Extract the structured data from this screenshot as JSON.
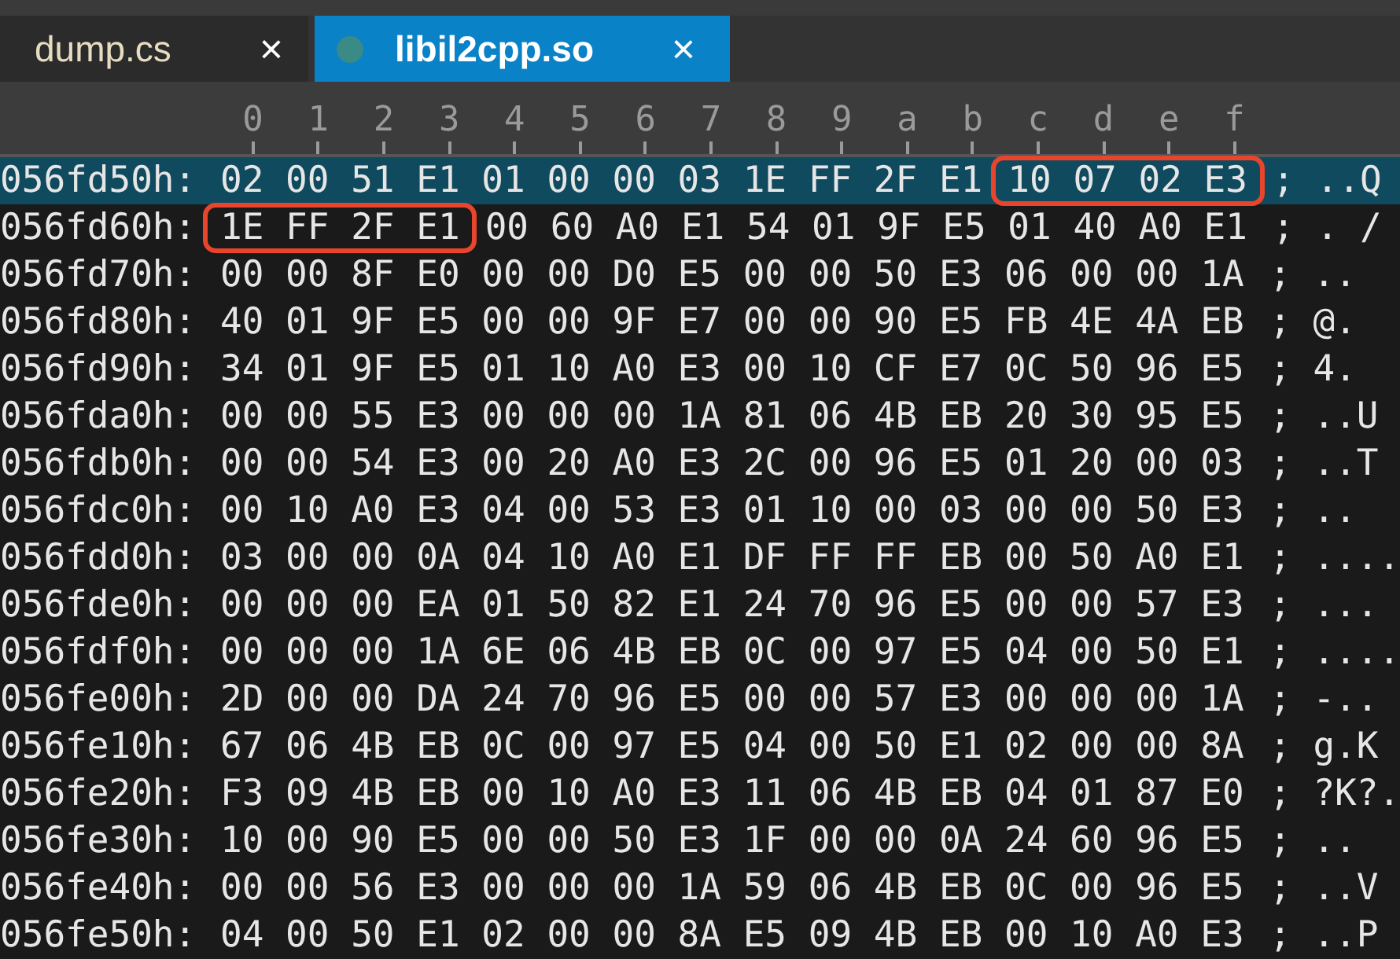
{
  "tabs": [
    {
      "label": "dump.cs",
      "close": "×",
      "selected": false,
      "modified": false
    },
    {
      "label": "libil2cpp.so",
      "close": "×",
      "selected": true,
      "modified": true
    }
  ],
  "columns": [
    "0",
    "1",
    "2",
    "3",
    "4",
    "5",
    "6",
    "7",
    "8",
    "9",
    "a",
    "b",
    "c",
    "d",
    "e",
    "f"
  ],
  "rows": [
    {
      "offset": "056fd50h:",
      "hex": [
        {
          "text": "02 00 51 E1 01 00 00 03 1E FF 2F E1",
          "marked": false
        },
        {
          "text": "10 07 02 E3",
          "marked": true
        }
      ],
      "separator": ";",
      "ascii": "..Q",
      "selected": true
    },
    {
      "offset": "056fd60h:",
      "hex": [
        {
          "text": "1E FF 2F E1",
          "marked": true
        },
        {
          "text": "00 60 A0 E1 54 01 9F E5 01 40 A0 E1",
          "marked": false
        }
      ],
      "separator": ";",
      "ascii": ". /",
      "selected": false
    },
    {
      "offset": "056fd70h:",
      "hex": [
        {
          "text": "00 00 8F E0 00 00 D0 E5 00 00 50 E3 06 00 00 1A",
          "marked": false
        }
      ],
      "separator": ";",
      "ascii": "..",
      "selected": false
    },
    {
      "offset": "056fd80h:",
      "hex": [
        {
          "text": "40 01 9F E5 00 00 9F E7 00 00 90 E5 FB 4E 4A EB",
          "marked": false
        }
      ],
      "separator": ";",
      "ascii": "@.",
      "selected": false
    },
    {
      "offset": "056fd90h:",
      "hex": [
        {
          "text": "34 01 9F E5 01 10 A0 E3 00 10 CF E7 0C 50 96 E5",
          "marked": false
        }
      ],
      "separator": ";",
      "ascii": "4.",
      "selected": false
    },
    {
      "offset": "056fda0h:",
      "hex": [
        {
          "text": "00 00 55 E3 00 00 00 1A 81 06 4B EB 20 30 95 E5",
          "marked": false
        }
      ],
      "separator": ";",
      "ascii": "..U",
      "selected": false
    },
    {
      "offset": "056fdb0h:",
      "hex": [
        {
          "text": "00 00 54 E3 00 20 A0 E3 2C 00 96 E5 01 20 00 03",
          "marked": false
        }
      ],
      "separator": ";",
      "ascii": "..T",
      "selected": false
    },
    {
      "offset": "056fdc0h:",
      "hex": [
        {
          "text": "00 10 A0 E3 04 00 53 E3 01 10 00 03 00 00 50 E3",
          "marked": false
        }
      ],
      "separator": ";",
      "ascii": "..",
      "selected": false
    },
    {
      "offset": "056fdd0h:",
      "hex": [
        {
          "text": "03 00 00 0A 04 10 A0 E1 DF FF FF EB 00 50 A0 E1",
          "marked": false
        }
      ],
      "separator": ";",
      "ascii": "....",
      "selected": false
    },
    {
      "offset": "056fde0h:",
      "hex": [
        {
          "text": "00 00 00 EA 01 50 82 E1 24 70 96 E5 00 00 57 E3",
          "marked": false
        }
      ],
      "separator": ";",
      "ascii": "...",
      "selected": false
    },
    {
      "offset": "056fdf0h:",
      "hex": [
        {
          "text": "00 00 00 1A 6E 06 4B EB 0C 00 97 E5 04 00 50 E1",
          "marked": false
        }
      ],
      "separator": ";",
      "ascii": "....",
      "selected": false
    },
    {
      "offset": "056fe00h:",
      "hex": [
        {
          "text": "2D 00 00 DA 24 70 96 E5 00 00 57 E3 00 00 00 1A",
          "marked": false
        }
      ],
      "separator": ";",
      "ascii": "-..",
      "selected": false
    },
    {
      "offset": "056fe10h:",
      "hex": [
        {
          "text": "67 06 4B EB 0C 00 97 E5 04 00 50 E1 02 00 00 8A",
          "marked": false
        }
      ],
      "separator": ";",
      "ascii": "g.K",
      "selected": false
    },
    {
      "offset": "056fe20h:",
      "hex": [
        {
          "text": "F3 09 4B EB 00 10 A0 E3 11 06 4B EB 04 01 87 E0",
          "marked": false
        }
      ],
      "separator": ";",
      "ascii": "?K?.",
      "selected": false
    },
    {
      "offset": "056fe30h:",
      "hex": [
        {
          "text": "10 00 90 E5 00 00 50 E3 1F 00 00 0A 24 60 96 E5",
          "marked": false
        }
      ],
      "separator": ";",
      "ascii": "..",
      "selected": false
    },
    {
      "offset": "056fe40h:",
      "hex": [
        {
          "text": "00 00 56 E3 00 00 00 1A 59 06 4B EB 0C 00 96 E5",
          "marked": false
        }
      ],
      "separator": ";",
      "ascii": "..V",
      "selected": false
    },
    {
      "offset": "056fe50h:",
      "hex": [
        {
          "text": "04 00 50 E1 02 00 00 8A E5 09 4B EB 00 10 A0 E3",
          "marked": false
        }
      ],
      "separator": ";",
      "ascii": "..P",
      "selected": false
    }
  ]
}
